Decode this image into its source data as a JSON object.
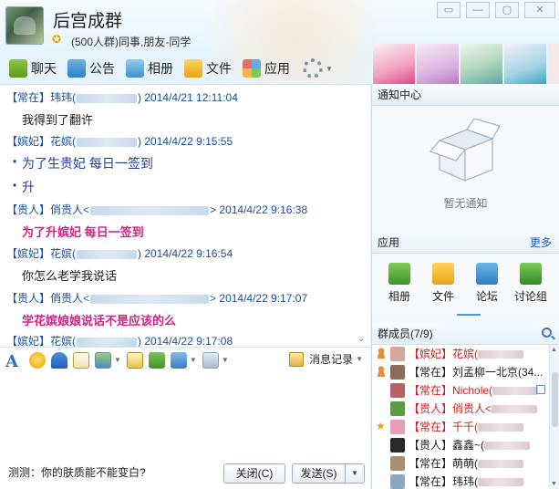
{
  "window": {
    "group_name": "后宫成群",
    "group_desc": "(500人群)同事,朋友-同学",
    "controls": [
      "▭",
      "—",
      "▢",
      "✕"
    ]
  },
  "toolbar": {
    "items": [
      {
        "label": "聊天",
        "icon": "chat-icon"
      },
      {
        "label": "公告",
        "icon": "announcement-icon"
      },
      {
        "label": "相册",
        "icon": "album-icon"
      },
      {
        "label": "文件",
        "icon": "file-icon"
      },
      {
        "label": "应用",
        "icon": "app-icon"
      }
    ],
    "settings_icon": "gear-icon"
  },
  "chat": {
    "messages": [
      {
        "rank": "【常在】",
        "name": "玮玮(",
        "tail": ")",
        "time": "2014/4/21 12:11:04"
      },
      {
        "body": "我得到了翻许"
      },
      {
        "rank": "【嫔妃】",
        "name": "花嫔(",
        "tail": ")",
        "time": "2014/4/22 9:15:55"
      },
      {
        "body": "为了生贵妃 每日一签到"
      },
      {
        "body": "升"
      },
      {
        "rank": "【贵人】",
        "name": "俏贵人<",
        "tail": ">",
        "time": "2014/4/22 9:16:38"
      },
      {
        "body": "为了升嫔妃 每日一签到"
      },
      {
        "rank": "【嫔妃】",
        "name": "花嫔(",
        "tail": ")",
        "time": "2014/4/22 9:16:54"
      },
      {
        "body": "你怎么老学我说话"
      },
      {
        "rank": "【贵人】",
        "name": "俏贵人<",
        "tail": ">",
        "time": "2014/4/22 9:17:07"
      },
      {
        "body": "学花嫔娘娘说话不是应该的么"
      },
      {
        "rank": "【嫔妃】",
        "name": "花嫔(",
        "tail": ")",
        "time": "2014/4/22 9:17:08"
      }
    ]
  },
  "input": {
    "font_label": "A",
    "history_label": "消息记录",
    "tip": "测测：你的肤质能不能变白?",
    "close_label": "关闭(C)",
    "send_label": "发送(S)"
  },
  "right": {
    "notice_title": "通知中心",
    "notice_empty": "暂无通知",
    "apps_title": "应用",
    "more_label": "更多",
    "apps": [
      {
        "label": "相册",
        "icon": "album-icon"
      },
      {
        "label": "文件",
        "icon": "file-icon"
      },
      {
        "label": "论坛",
        "icon": "forum-icon"
      },
      {
        "label": "讨论组",
        "icon": "discussion-group-icon"
      }
    ],
    "members_title": "群成员(7/9)",
    "members": [
      {
        "rank": "【嫔妃】",
        "name": "花嫔(",
        "color": "red",
        "badge": "person",
        "av": "#d7a6a2"
      },
      {
        "rank": "【常在】",
        "name": "刘孟柳一北京(34...",
        "color": "dark",
        "badge": "person",
        "av": "#8a6a5a"
      },
      {
        "rank": "【常在】",
        "name": "Nichole(",
        "color": "red",
        "badge": "",
        "av": "#b46464"
      },
      {
        "rank": "【贵人】",
        "name": "俏贵人<",
        "color": "red",
        "badge": "",
        "av": "#5e9a45"
      },
      {
        "rank": "【常在】",
        "name": "千千(",
        "color": "red",
        "badge": "crown",
        "av": "#e7a0b6"
      },
      {
        "rank": "【贵人】",
        "name": "鑫鑫~(",
        "color": "dark",
        "badge": "",
        "av": "#2a2a2a"
      },
      {
        "rank": "【常在】",
        "name": "萌萌(",
        "color": "dark",
        "badge": "",
        "av": "#a98e74"
      },
      {
        "rank": "【常在】",
        "name": "玮玮(",
        "color": "dark",
        "badge": "",
        "av": "#8aa6c2"
      }
    ]
  }
}
